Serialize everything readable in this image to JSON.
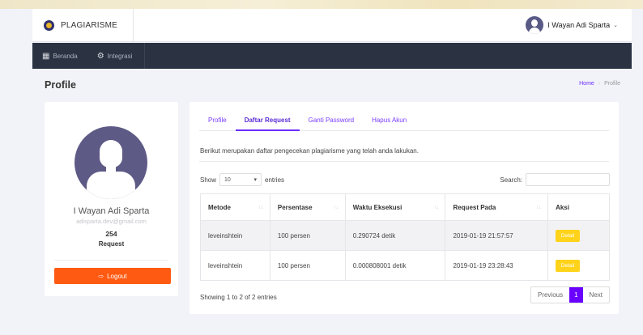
{
  "app": {
    "brand": "PLAGIARISME",
    "user_name": "I Wayan Adi Sparta",
    "user_caret": "⌄"
  },
  "nav": {
    "items": [
      {
        "icon": "grid-icon",
        "glyph": "▦",
        "label": "Beranda"
      },
      {
        "icon": "cogs-icon",
        "glyph": "⚙",
        "label": "Integrasi"
      }
    ]
  },
  "page": {
    "title": "Profile",
    "breadcrumb": {
      "home": "Home",
      "separator": "›",
      "current": "Profile"
    }
  },
  "profile": {
    "name": "I Wayan Adi Sparta",
    "email": "adisparta.dev@gmail.com",
    "request_count": "254",
    "request_label": "Request",
    "logout_label": "Logout",
    "logout_glyph": "⇨"
  },
  "tabs": [
    {
      "label": "Profile",
      "active": false
    },
    {
      "label": "Daftar Request",
      "active": true
    },
    {
      "label": "Ganti Password",
      "active": false
    },
    {
      "label": "Hapus Akun",
      "active": false
    }
  ],
  "content": {
    "intro": "Berikut merupakan daftar pengecekan plagiarisme yang telah anda lakukan.",
    "show_label": "Show",
    "page_size": "10",
    "select_caret": "▾",
    "entries_label": "entries",
    "search_label": "Search:"
  },
  "table": {
    "columns": [
      "Metode",
      "Persentase",
      "Waktu Eksekusi",
      "Request Pada",
      "Aksi"
    ],
    "sort_glyph": "↑↓",
    "rows": [
      {
        "metode": "leveinshtein",
        "persentase": "100 persen",
        "waktu": "0.290724 detik",
        "request_pada": "2019-01-19 21:57:57",
        "aksi": "Detail"
      },
      {
        "metode": "leveinshtein",
        "persentase": "100 persen",
        "waktu": "0.000808001 detik",
        "request_pada": "2019-01-19 23:28:43",
        "aksi": "Detail"
      }
    ]
  },
  "pagination": {
    "info": "Showing 1 to 2 of 2 entries",
    "previous": "Previous",
    "current": "1",
    "next": "Next"
  },
  "colors": {
    "accent": "#6a2cff",
    "navbar": "#2b3342",
    "logout": "#ff5a12",
    "detail_button": "#ffd31a"
  }
}
